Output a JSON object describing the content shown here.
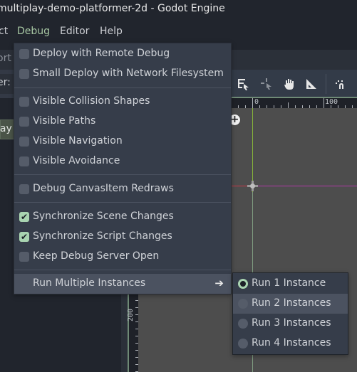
{
  "window": {
    "title": "multiplay-demo-platformer-2d - Godot Engine"
  },
  "menubar": {
    "items": [
      {
        "label": "ct",
        "active": false
      },
      {
        "label": "Debug",
        "active": true
      },
      {
        "label": "Editor",
        "active": false
      },
      {
        "label": "Help",
        "active": false
      }
    ]
  },
  "left_dock": {
    "tab_label": "ort",
    "filter_label": "er: ",
    "node_label": "lay"
  },
  "toolbar": {
    "icons": [
      "list-select-icon",
      "pivot-icon",
      "pan-hand-icon",
      "ruler-icon",
      "snap-icon"
    ]
  },
  "ruler": {
    "top_labels": [
      "0",
      "100"
    ],
    "left_labels": [
      "200"
    ]
  },
  "debug_menu": {
    "items": [
      {
        "label": "Deploy with Remote Debug",
        "checked": false
      },
      {
        "label": "Small Deploy with Network Filesystem",
        "checked": false
      },
      {
        "label": "Visible Collision Shapes",
        "checked": false
      },
      {
        "label": "Visible Paths",
        "checked": false
      },
      {
        "label": "Visible Navigation",
        "checked": false
      },
      {
        "label": "Visible Avoidance",
        "checked": false
      },
      {
        "label": "Debug CanvasItem Redraws",
        "checked": false
      },
      {
        "label": "Synchronize Scene Changes",
        "checked": true
      },
      {
        "label": "Synchronize Script Changes",
        "checked": true
      },
      {
        "label": "Keep Debug Server Open",
        "checked": false
      },
      {
        "label": "Run Multiple Instances",
        "submenu": true
      }
    ],
    "check_glyph": "✔",
    "submenu_arrow": "➔"
  },
  "instances_menu": {
    "items": [
      {
        "label": "Run 1 Instance",
        "selected": true
      },
      {
        "label": "Run 2 Instances",
        "selected": false
      },
      {
        "label": "Run 3 Instances",
        "selected": false
      },
      {
        "label": "Run 4 Instances",
        "selected": false
      }
    ]
  },
  "colors": {
    "accent": "#a9d4b1",
    "menu_bg": "#363d4a",
    "canvas_bg": "#4d4d4d"
  }
}
